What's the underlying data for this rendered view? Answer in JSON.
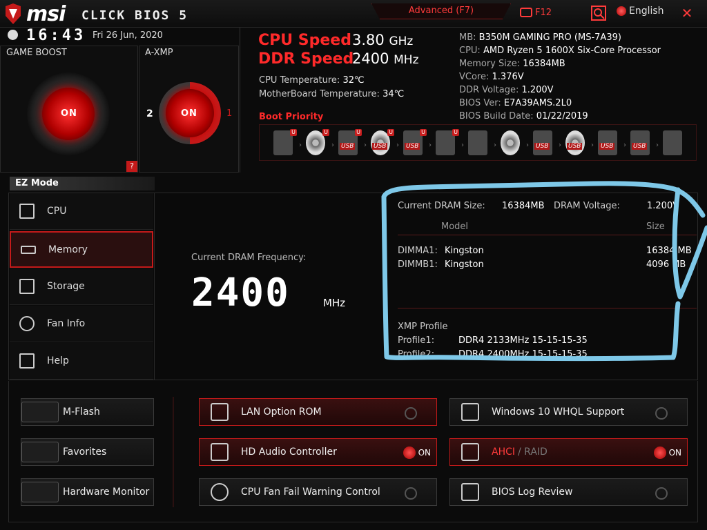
{
  "header": {
    "brand": "msi",
    "product": "CLICK BIOS 5",
    "advanced_label": "Advanced (F7)",
    "screenshot_label": "F12",
    "language_label": "English",
    "close_glyph": "✕"
  },
  "clock": {
    "time": "16:43",
    "date": "Fri  26 Jun, 2020"
  },
  "game_boost": {
    "title": "GAME BOOST",
    "state": "ON",
    "help": "?"
  },
  "a_xmp": {
    "title": "A-XMP",
    "state": "ON",
    "left_profile": "2",
    "right_profile": "1"
  },
  "speeds": {
    "cpu_label": "CPU Speed",
    "cpu_value": "3.80",
    "cpu_unit": "GHz",
    "ddr_label": "DDR Speed",
    "ddr_value": "2400",
    "ddr_unit": "MHz"
  },
  "temps": {
    "cpu_label": "CPU Temperature:",
    "cpu_value": "32℃",
    "mb_label": "MotherBoard Temperature:",
    "mb_value": "34℃"
  },
  "system": [
    {
      "label": "MB:",
      "value": "B350M GAMING PRO (MS-7A39)"
    },
    {
      "label": "CPU:",
      "value": "AMD Ryzen 5 1600X Six-Core Processor"
    },
    {
      "label": "Memory Size:",
      "value": "16384MB"
    },
    {
      "label": "VCore:",
      "value": "1.376V"
    },
    {
      "label": "DDR Voltage:",
      "value": "1.200V"
    },
    {
      "label": "BIOS Ver:",
      "value": "E7A39AMS.2L0"
    },
    {
      "label": "BIOS Build Date:",
      "value": "01/22/2019"
    }
  ],
  "boot": {
    "label": "Boot Priority",
    "devices": [
      {
        "icon": "hdd-icon",
        "badge": "U",
        "tag": ""
      },
      {
        "icon": "disc-icon",
        "badge": "U",
        "tag": ""
      },
      {
        "icon": "usb-drive-icon",
        "badge": "U",
        "tag": "USB"
      },
      {
        "icon": "usb-disc-icon",
        "badge": "U",
        "tag": "USB"
      },
      {
        "icon": "usb-key-icon",
        "badge": "U",
        "tag": "USB"
      },
      {
        "icon": "network-icon",
        "badge": "U",
        "tag": ""
      },
      {
        "icon": "hdd-icon",
        "badge": "",
        "tag": ""
      },
      {
        "icon": "disc-icon",
        "badge": "",
        "tag": ""
      },
      {
        "icon": "usb-drive-icon",
        "badge": "",
        "tag": "USB"
      },
      {
        "icon": "usb-disc-icon",
        "badge": "",
        "tag": "USB"
      },
      {
        "icon": "usb-key-icon",
        "badge": "",
        "tag": "USB"
      },
      {
        "icon": "floppy-icon",
        "badge": "",
        "tag": "USB"
      },
      {
        "icon": "network-icon",
        "badge": "",
        "tag": ""
      }
    ]
  },
  "ez_mode": {
    "tab_label": "EZ Mode",
    "nav": [
      {
        "label": "CPU",
        "icon": "cpu-icon"
      },
      {
        "label": "Memory",
        "icon": "memory-icon"
      },
      {
        "label": "Storage",
        "icon": "storage-icon"
      },
      {
        "label": "Fan Info",
        "icon": "fan-icon"
      },
      {
        "label": "Help",
        "icon": "hotkey-icon"
      }
    ],
    "active_index": 1
  },
  "memory": {
    "freq_label": "Current DRAM Frequency:",
    "freq_value": "2400",
    "freq_unit": "MHz",
    "dram_size_label": "Current DRAM Size:",
    "dram_size_value": "16384MB",
    "dram_voltage_label": "DRAM Voltage:",
    "dram_voltage_value": "1.200V",
    "col_model": "Model",
    "col_size": "Size",
    "dimms": [
      {
        "slot": "DIMMA1:",
        "model": "Kingston",
        "size": "16384 MB"
      },
      {
        "slot": "DIMMB1:",
        "model": "Kingston",
        "size": "4096 MB"
      }
    ],
    "xmp_label": "XMP Profile",
    "profiles": [
      {
        "name": "Profile1:",
        "value": "DDR4 2133MHz 15-15-15-35"
      },
      {
        "name": "Profile2:",
        "value": "DDR4 2400MHz 15-15-15-35"
      }
    ]
  },
  "bottom": {
    "left": [
      {
        "label": "M-Flash",
        "icon": "usb-flash-icon"
      },
      {
        "label": "Favorites",
        "icon": "favorites-icon"
      },
      {
        "label": "Hardware Monitor",
        "icon": "hardware-monitor-icon"
      }
    ],
    "mid": [
      {
        "label": "LAN Option ROM",
        "icon": "lan-icon",
        "on": false
      },
      {
        "label": "HD Audio Controller",
        "icon": "audio-icon",
        "on": true
      },
      {
        "label": "CPU Fan Fail Warning Control",
        "icon": "fan-warning-icon",
        "on": false
      }
    ],
    "right": [
      {
        "label": "Windows 10 WHQL Support",
        "icon": "whql-icon",
        "on": false
      },
      {
        "label": "AHCI",
        "label2": "/ RAID",
        "icon": "ahci-icon",
        "on": true
      },
      {
        "label": "BIOS Log Review",
        "icon": "bios-log-icon",
        "on": false
      }
    ],
    "on_text": "ON"
  },
  "colors": {
    "accent": "#ff2a2a",
    "annotation": "#7ec8e8"
  }
}
